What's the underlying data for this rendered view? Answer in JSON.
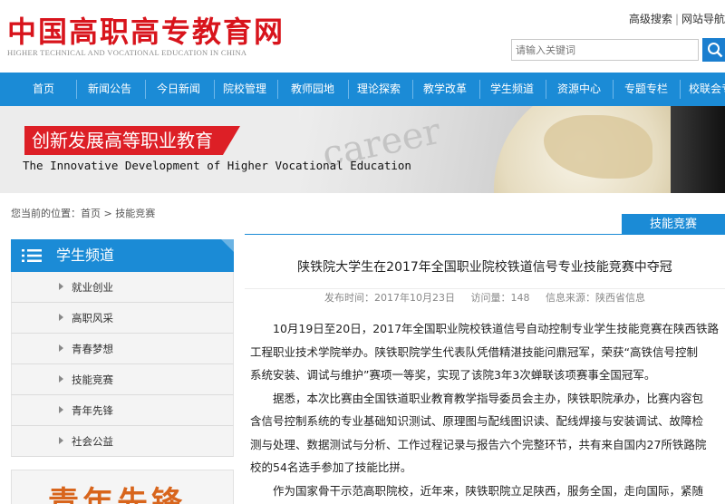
{
  "header": {
    "logo_cn": "中国高职高专教育网",
    "logo_en": "HIGHER TECHNICAL AND VOCATIONAL EDUCATION IN CHINA",
    "links": [
      "高级搜索",
      "网站导航"
    ],
    "search_placeholder": "请输入关键词"
  },
  "nav": [
    "首页",
    "新闻公告",
    "今日新闻",
    "院校管理",
    "教师园地",
    "理论探索",
    "教学改革",
    "学生频道",
    "资源中心",
    "专题专栏",
    "校联会专"
  ],
  "banner": {
    "title_cn": "创新发展高等职业教育",
    "title_en": "The Innovative Development of Higher Vocational Education",
    "paper_word": "career"
  },
  "breadcrumb": "您当前的位置：首页 > 技能竞赛",
  "section_tab": "技能竞赛",
  "sidebar": {
    "title": "学生频道",
    "items": [
      "就业创业",
      "高职风采",
      "青春梦想",
      "技能竞赛",
      "青年先锋",
      "社会公益"
    ],
    "promo": "青年先锋"
  },
  "article": {
    "title": "陕铁院大学生在2017年全国职业院校铁道信号专业技能竞赛中夺冠",
    "meta": {
      "published": "发布时间：2017年10月23日",
      "views": "访问量：148",
      "source": "信息来源：陕西省信息"
    },
    "lines": [
      "10月19日至20日，2017年全国职业院校铁道信号自动控制专业学生技能竞赛在陕西铁路",
      "工程职业技术学院举办。陕铁职院学生代表队凭借精湛技能问鼎冠军，荣获“高铁信号控制",
      "系统安装、调试与维护”赛项一等奖，实现了该院3年3次蝉联该项赛事全国冠军。",
      "据悉，本次比赛由全国铁道职业教育教学指导委员会主办，陕铁职院承办，比赛内容包",
      "含信号控制系统的专业基础知识测试、原理图与配线图识读、配线焊接与安装调试、故障检",
      "测与处理、数据测试与分析、工作过程记录与报告六个完整环节，共有来自国内27所铁路院",
      "校的54名选手参加了技能比拼。",
      "作为国家骨干示范高职院校，近年来，陕铁职院立足陕西，服务全国，走向国际，紧随"
    ]
  },
  "colors": {
    "nav_blue": "#1b8bd6",
    "brand_red": "#d8141c"
  }
}
